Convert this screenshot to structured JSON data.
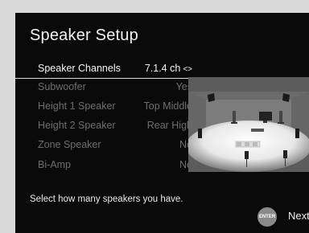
{
  "screen": {
    "title": "Speaker Setup",
    "menu": [
      {
        "label": "Speaker Channels",
        "value": "7.1.4 ch",
        "arrows": "<>",
        "selected": true
      },
      {
        "label": "Subwoofer",
        "value": "Yes",
        "selected": false
      },
      {
        "label": "Height 1 Speaker",
        "value": "Top Middle",
        "selected": false
      },
      {
        "label": "Height 2 Speaker",
        "value": "Rear High",
        "selected": false
      },
      {
        "label": "Zone Speaker",
        "value": "No",
        "selected": false
      },
      {
        "label": "Bi-Amp",
        "value": "No",
        "selected": false
      }
    ],
    "help_text": "Select how many speakers you have.",
    "enter_icon_text": "ENTER",
    "next_label": "Next",
    "colors": {
      "background": "#0a0a0a",
      "frame": "#d9d9d9",
      "room": "#5a5a5a",
      "text_dim": "#6e6e6e"
    }
  }
}
